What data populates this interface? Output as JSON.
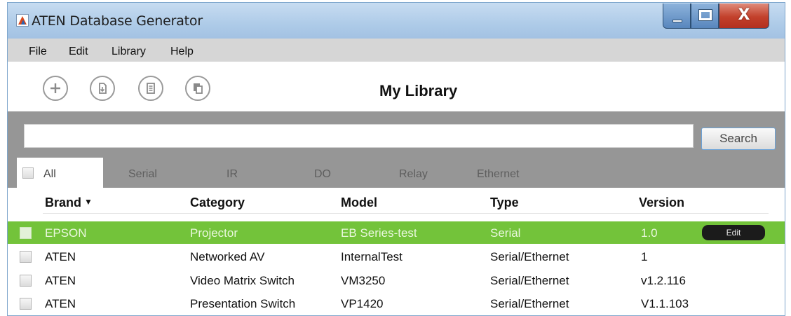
{
  "window": {
    "title": "ATEN Database Generator",
    "icons": {
      "app": "aten-logo-icon",
      "minimize": "minimize-icon",
      "maximize": "maximize-icon",
      "close": "close-icon"
    },
    "close_glyph": "X"
  },
  "menu": [
    "File",
    "Edit",
    "Library",
    "Help"
  ],
  "toolbar": {
    "buttons": [
      "add-icon",
      "import-icon",
      "list-icon",
      "copy-icon"
    ],
    "title": "My Library"
  },
  "search": {
    "value": "",
    "placeholder": "",
    "button_label": "Search"
  },
  "tabs": [
    "All",
    "Serial",
    "IR",
    "DO",
    "Relay",
    "Ethernet"
  ],
  "active_tab": "All",
  "table": {
    "columns": [
      "Brand",
      "Category",
      "Model",
      "Type",
      "Version"
    ],
    "sort_indicator": "▼",
    "sorted_column": "Brand",
    "rows": [
      {
        "brand": "EPSON",
        "category": "Projector",
        "model": "EB Series-test",
        "type": "Serial",
        "version": "1.0",
        "selected": true,
        "action": "Edit"
      },
      {
        "brand": "ATEN",
        "category": "Networked AV",
        "model": "InternalTest",
        "type": "Serial/Ethernet",
        "version": "1",
        "selected": false
      },
      {
        "brand": "ATEN",
        "category": "Video Matrix Switch",
        "model": "VM3250",
        "type": "Serial/Ethernet",
        "version": "v1.2.116",
        "selected": false
      },
      {
        "brand": "ATEN",
        "category": "Presentation Switch",
        "model": "VP1420",
        "type": "Serial/Ethernet",
        "version": "V1.1.103",
        "selected": false
      }
    ]
  },
  "colors": {
    "selected_row": "#73c33a",
    "titlebar": "#aecbe8",
    "gray_band": "#969696",
    "menubar": "#d6d6d6"
  }
}
